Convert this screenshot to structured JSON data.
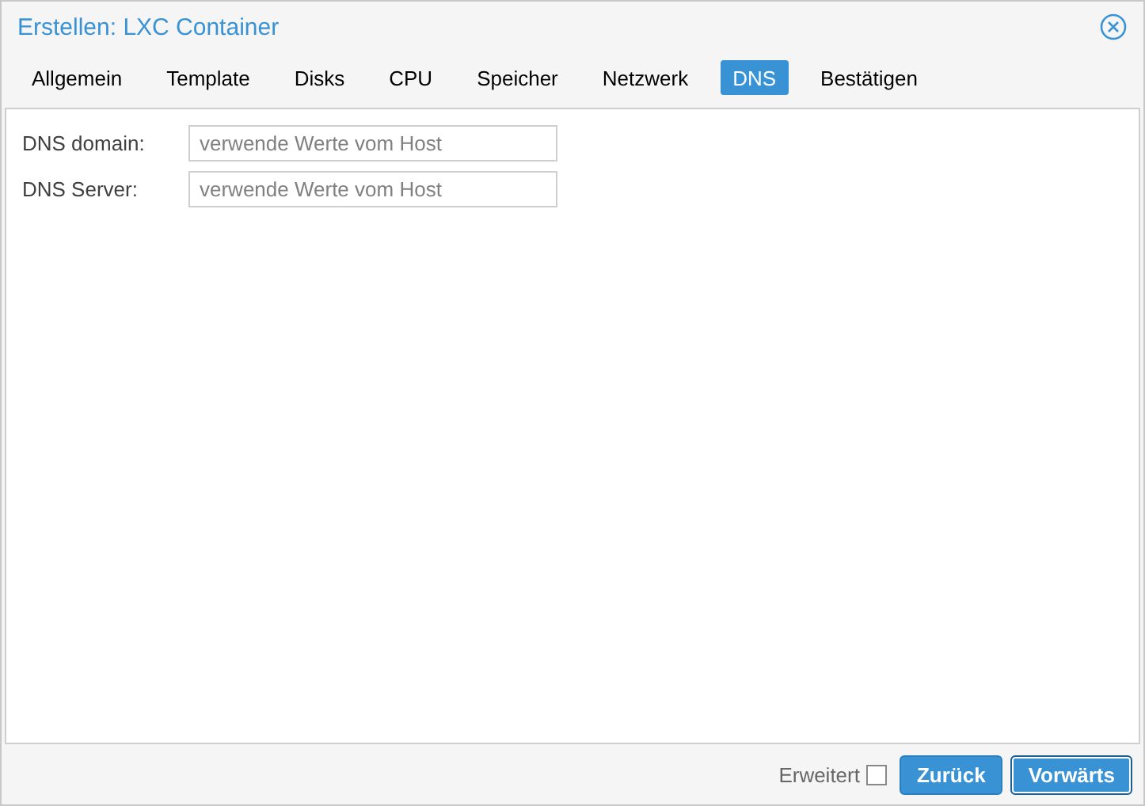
{
  "window": {
    "title": "Erstellen: LXC Container"
  },
  "tabs": [
    {
      "label": "Allgemein",
      "selected": false
    },
    {
      "label": "Template",
      "selected": false
    },
    {
      "label": "Disks",
      "selected": false
    },
    {
      "label": "CPU",
      "selected": false
    },
    {
      "label": "Speicher",
      "selected": false
    },
    {
      "label": "Netzwerk",
      "selected": false
    },
    {
      "label": "DNS",
      "selected": true
    },
    {
      "label": "Bestätigen",
      "selected": false
    }
  ],
  "fields": [
    {
      "label": "DNS domain:",
      "placeholder": "verwende Werte vom Host"
    },
    {
      "label": "DNS Server:",
      "placeholder": "verwende Werte vom Host"
    }
  ],
  "footer": {
    "advanced": {
      "label": "Erweitert",
      "checked": false
    },
    "buttons": [
      {
        "label": "Zurück",
        "focused": false
      },
      {
        "label": "Vorwärts",
        "focused": true
      }
    ]
  }
}
